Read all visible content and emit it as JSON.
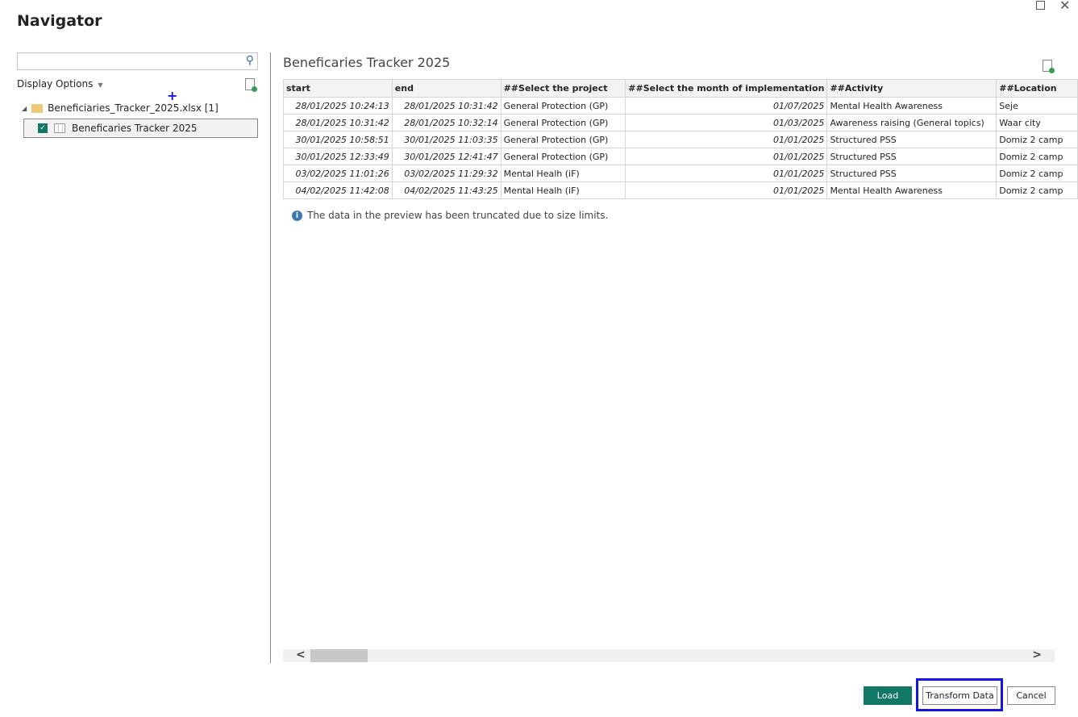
{
  "window": {
    "title": "Navigator"
  },
  "left": {
    "search_placeholder": "",
    "display_options": "Display Options",
    "tree": {
      "file": "Beneficiaries_Tracker_2025.xlsx [1]",
      "sheet": "Beneficaries Tracker 2025"
    }
  },
  "preview": {
    "title": "Beneficaries Tracker 2025",
    "columns": [
      "start",
      "end",
      "##Select the project",
      "##Select the month of implementation",
      "##Activity",
      "##Location"
    ],
    "rows": [
      [
        "28/01/2025 10:24:13",
        "28/01/2025 10:31:42",
        "General Protection (GP)",
        "01/07/2025",
        "Mental Health Awareness",
        "Seje"
      ],
      [
        "28/01/2025 10:31:42",
        "28/01/2025 10:32:14",
        "General Protection (GP)",
        "01/03/2025",
        "Awareness raising (General topics)",
        "Waar city"
      ],
      [
        "30/01/2025 10:58:51",
        "30/01/2025 11:03:35",
        "General Protection (GP)",
        "01/01/2025",
        "Structured PSS",
        "Domiz 2 camp"
      ],
      [
        "30/01/2025 12:33:49",
        "30/01/2025 12:41:47",
        "General Protection (GP)",
        "01/01/2025",
        "Structured PSS",
        "Domiz 2 camp"
      ],
      [
        "03/02/2025 11:01:26",
        "03/02/2025 11:29:32",
        "Mental Healh (iF)",
        "01/01/2025",
        "Structured PSS",
        "Domiz 2 camp"
      ],
      [
        "04/02/2025 11:42:08",
        "04/02/2025 11:43:25",
        "Mental Healh (iF)",
        "01/01/2025",
        "Mental Health Awareness",
        "Domiz 2 camp"
      ]
    ],
    "note": "The data in the preview has been truncated due to size limits."
  },
  "buttons": {
    "load": "Load",
    "transform": "Transform Data",
    "cancel": "Cancel"
  },
  "colors": {
    "accent": "#117865",
    "highlight": "#1515e0"
  }
}
